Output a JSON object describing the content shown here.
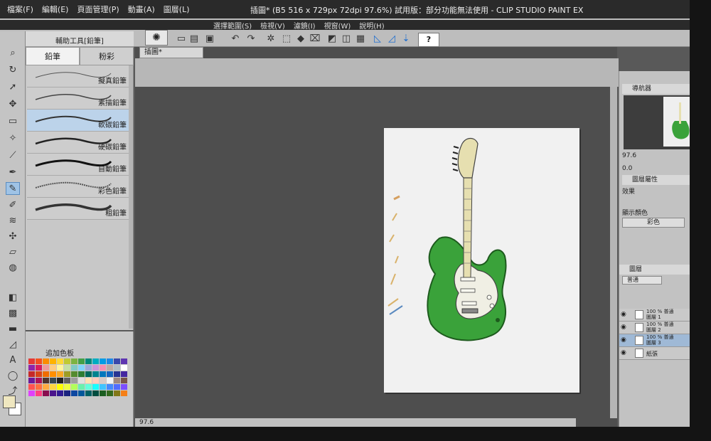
{
  "window": {
    "title": "插圖* (B5 516 x 729px 72dpi 97.6%) 試用版：部分功能無法使用 - CLIP STUDIO PAINT EX"
  },
  "menu": [
    {
      "label": "檔案(F)"
    },
    {
      "label": "編輯(E)"
    },
    {
      "label": "頁面管理(P)"
    },
    {
      "label": "動畫(A)"
    },
    {
      "label": "圖層(L)"
    },
    {
      "label": "選擇範圍(S)"
    },
    {
      "label": "檢視(V)"
    },
    {
      "label": "濾鏡(I)"
    },
    {
      "label": "視窗(W)"
    },
    {
      "label": "說明(H)"
    }
  ],
  "toolbar": {
    "help_label": "?",
    "icons": [
      "new-file-icon",
      "open-file-icon",
      "save-icon",
      "undo-icon",
      "redo-icon",
      "transform-icon",
      "clear-icon",
      "fill-icon",
      "ruler-icon",
      "snap-icon"
    ]
  },
  "subtool_panel": {
    "header": "輔助工具[鉛筆]",
    "tabs": [
      {
        "label": "鉛筆",
        "active": true
      },
      {
        "label": "粉彩",
        "active": false
      }
    ],
    "brushes": [
      {
        "label": "擬真鉛筆",
        "active": false
      },
      {
        "label": "素描鉛筆",
        "active": false
      },
      {
        "label": "軟碳鉛筆",
        "active": true
      },
      {
        "label": "硬碳鉛筆",
        "active": false
      },
      {
        "label": "自動鉛筆",
        "active": false
      },
      {
        "label": "彩色鉛筆",
        "active": false
      },
      {
        "label": "粗鉛筆",
        "active": false
      }
    ]
  },
  "palette": {
    "title": "追加色板",
    "colors": [
      "#e53935",
      "#f4511e",
      "#fb8c00",
      "#ffb300",
      "#fdd835",
      "#c0ca33",
      "#7cb342",
      "#43a047",
      "#00897b",
      "#00acc1",
      "#039be5",
      "#1e88e5",
      "#3949ab",
      "#5e35b1",
      "#8e24aa",
      "#d81b60",
      "#ef9a9a",
      "#ffcc80",
      "#fff59d",
      "#c5e1a5",
      "#80cbc4",
      "#81d4fa",
      "#9fa8da",
      "#ce93d8",
      "#f48fb1",
      "#bcaaa4",
      "#b0bec5",
      "#ffffff",
      "#c62828",
      "#d84315",
      "#ef6c00",
      "#ff8f00",
      "#f9a825",
      "#9e9d24",
      "#558b2f",
      "#2e7d32",
      "#00695c",
      "#00838f",
      "#0277bd",
      "#1565c0",
      "#283593",
      "#4527a0",
      "#6a1b9a",
      "#ad1457",
      "#4e342e",
      "#37474f",
      "#212121",
      "#616161",
      "#9e9e9e",
      "#e0e0e0",
      "#ffe0b2",
      "#ffccbc",
      "#d7ccc8",
      "#f5f5f5",
      "#a1887f",
      "#795548",
      "#ff5252",
      "#ff6e40",
      "#ffab40",
      "#ffd740",
      "#ffff00",
      "#eeff41",
      "#b2ff59",
      "#69f0ae",
      "#64ffda",
      "#18ffff",
      "#40c4ff",
      "#448aff",
      "#536dfe",
      "#7c4dff",
      "#e040fb",
      "#ff4081",
      "#880e4f",
      "#4a148c",
      "#311b92",
      "#1a237e",
      "#0d47a1",
      "#01579b",
      "#006064",
      "#004d40",
      "#1b5e20",
      "#33691e",
      "#827717",
      "#f57f17"
    ]
  },
  "canvas": {
    "tab_label": "插圖*",
    "status_zoom": "97.6"
  },
  "navigator": {
    "tab_label": "導航器",
    "zoom": "97.6",
    "rotation": "0.0"
  },
  "properties": {
    "tab_label": "圖層屬性",
    "effect_label": "效果",
    "display_color_label": "顯示顏色",
    "color_mode": "彩色"
  },
  "layers_panel": {
    "tab_label": "圖層",
    "blend_mode": "普通",
    "opacity": "100",
    "layers": [
      {
        "line1": "100 % 普通",
        "line2": "圖層 1",
        "active": false
      },
      {
        "line1": "100 % 普通",
        "line2": "圖層 2",
        "active": false
      },
      {
        "line1": "100 % 普通",
        "line2": "圖層 3",
        "active": true
      },
      {
        "line1": "",
        "line2": "紙張",
        "active": false
      }
    ]
  },
  "colors": {
    "guitar_body": "#3aa23a",
    "neck": "#e6dfb0",
    "pickguard": "#f0efe4"
  }
}
